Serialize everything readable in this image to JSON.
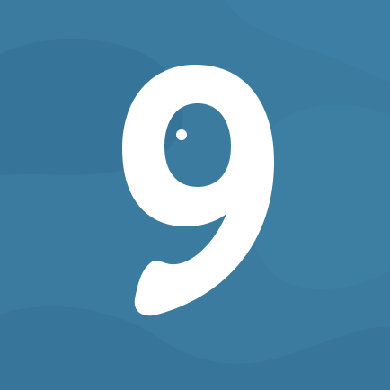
{
  "icon": {
    "glyph": "9",
    "background_color": "#3b7ba0",
    "shade_color": "#356f93",
    "glyph_color": "#ffffff",
    "eye_color": "#3b7ba0",
    "eye_highlight_color": "#ffffff",
    "icon_name": "nine-icon"
  }
}
